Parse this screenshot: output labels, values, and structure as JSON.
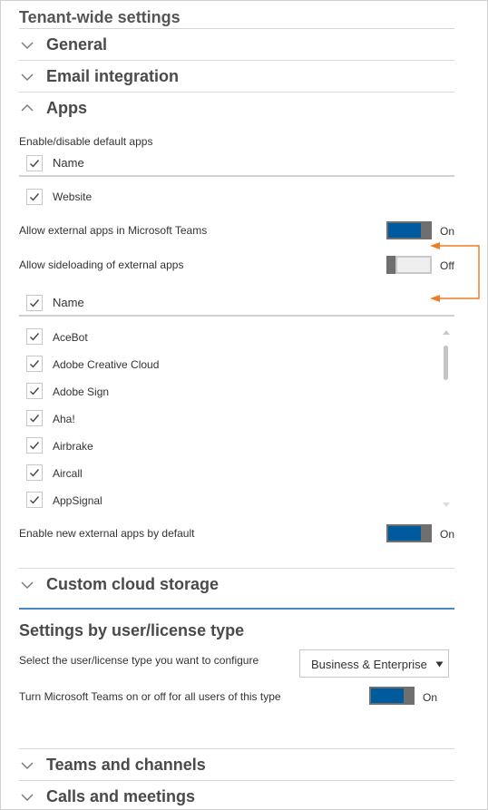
{
  "tenant": {
    "title": "Tenant-wide settings"
  },
  "sections": {
    "general": "General",
    "email": "Email integration",
    "apps": "Apps",
    "custom_storage": "Custom cloud storage",
    "teams_channels": "Teams and channels",
    "calls_meetings": "Calls and meetings"
  },
  "apps": {
    "default_label": "Enable/disable default apps",
    "default_header": "Name",
    "default_items": [
      "Website"
    ],
    "allow_external": {
      "label": "Allow external apps in Microsoft Teams",
      "state": "On"
    },
    "allow_sideload": {
      "label": "Allow sideloading of external apps",
      "state": "Off"
    },
    "external_header": "Name",
    "external_items": [
      "AceBot",
      "Adobe Creative Cloud",
      "Adobe Sign",
      "Aha!",
      "Airbrake",
      "Aircall",
      "AppSignal"
    ],
    "enable_new": {
      "label": "Enable new external apps by default",
      "state": "On"
    }
  },
  "user_settings": {
    "title": "Settings by user/license type",
    "select_label": "Select the user/license type you want to configure",
    "select_value": "Business & Enterprise",
    "toggle_label": "Turn Microsoft Teams on or off for all users of this type",
    "toggle_state": "On"
  },
  "colors": {
    "accent": "#005a9e",
    "annotation": "#f07c24"
  }
}
